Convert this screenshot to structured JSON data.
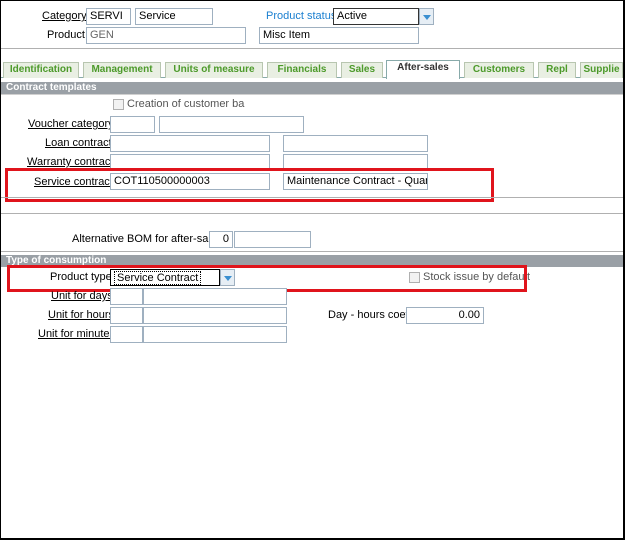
{
  "header": {
    "category_label": "Category",
    "category_code": "SERVI",
    "category_name": "Service",
    "product_status_label": "Product status",
    "product_status_value": "Active",
    "product_label": "Product",
    "product_code": "GEN",
    "product_desc": "Misc Item"
  },
  "tabs": [
    "Identification",
    "Management",
    "Units of measure",
    "Financials",
    "Sales",
    "After-sales",
    "Customers",
    "Repl",
    "Supplie"
  ],
  "active_tab": "After-sales",
  "contract_templates": {
    "title": "Contract templates",
    "creation_label": "Creation of customer ba",
    "voucher_label": "Voucher category",
    "loan_label": "Loan contract",
    "warranty_label": "Warranty contract",
    "service_label": "Service contract",
    "service_code": "COT110500000003",
    "service_desc": "Maintenance Contract - Quarterl"
  },
  "alt_bom": {
    "label": "Alternative BOM for after-sales",
    "value": "0"
  },
  "consumption": {
    "title": "Type of consumption",
    "product_type_label": "Product type",
    "product_type_value": "Service Contract",
    "stock_issue_label": "Stock issue by default",
    "unit_days_label": "Unit for days",
    "unit_hours_label": "Unit for hours",
    "unit_minutes_label": "Unit for minutes",
    "day_hours_label": "Day - hours coeff",
    "day_hours_value": "0.00"
  },
  "colors": {
    "highlight": "#e0141c",
    "tab_text": "#4c9a2a",
    "link_blue": "#1a7fd0"
  }
}
